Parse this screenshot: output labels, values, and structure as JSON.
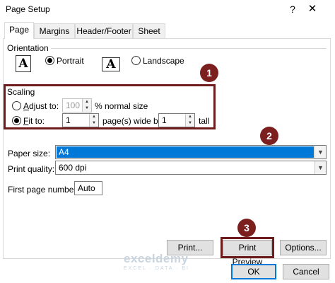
{
  "window": {
    "title": "Page Setup",
    "help_glyph": "?",
    "close_glyph": "✕"
  },
  "tabs": [
    {
      "label": "Page",
      "active": true
    },
    {
      "label": "Margins",
      "active": false
    },
    {
      "label": "Header/Footer",
      "active": false
    },
    {
      "label": "Sheet",
      "active": false
    }
  ],
  "orientation": {
    "heading": "Orientation",
    "icon_letter": "A",
    "portrait_label": "Portrait",
    "landscape_label": "Landscape",
    "selected": "Portrait"
  },
  "scaling": {
    "heading": "Scaling",
    "adjust_label": "Adjust to:",
    "adjust_value": "100",
    "adjust_suffix": "% normal size",
    "fit_label": "Fit to:",
    "fit_wide_value": "1",
    "fit_wide_suffix": "page(s) wide by",
    "fit_tall_value": "1",
    "fit_tall_suffix": "tall",
    "selected": "Fit to:"
  },
  "paper": {
    "size_label": "Paper size:",
    "size_value": "A4",
    "quality_label": "Print quality:",
    "quality_value": "600 dpi",
    "first_page_label": "First page number:",
    "first_page_value": "Auto"
  },
  "buttons": {
    "print": "Print...",
    "print_preview": "Print Preview",
    "options": "Options...",
    "ok": "OK",
    "cancel": "Cancel"
  },
  "annotations": [
    "1",
    "2",
    "3"
  ],
  "watermark": {
    "name": "exceldemy",
    "tagline": "EXCEL · DATA · BI"
  },
  "colors": {
    "annotation": "#7b1f1f",
    "selection": "#0078d7"
  }
}
